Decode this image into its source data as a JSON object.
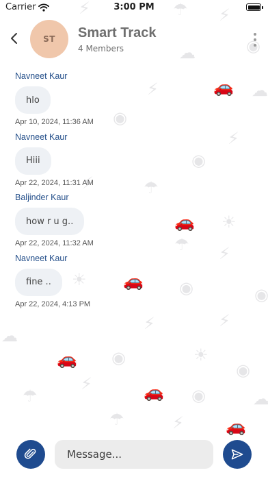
{
  "status_bar": {
    "carrier": "Carrier",
    "time": "3:00 PM"
  },
  "header": {
    "avatar_initials": "ST",
    "title": "Smart Track",
    "subtitle": "4 Members"
  },
  "messages": [
    {
      "sender": "Navneet Kaur",
      "text": "hlo",
      "timestamp": "Apr 10, 2024, 11:36 AM"
    },
    {
      "sender": "Navneet Kaur",
      "text": "Hiii",
      "timestamp": "Apr 22, 2024, 11:31 AM"
    },
    {
      "sender": "Baljinder Kaur",
      "text": "how r u g..",
      "timestamp": "Apr 22, 2024, 11:32 AM"
    },
    {
      "sender": "Navneet Kaur",
      "text": "fine ..",
      "timestamp": "Apr 22, 2024, 4:13 PM"
    }
  ],
  "composer": {
    "placeholder": "Message..."
  },
  "icons": {
    "back": "chevron-left-icon",
    "menu": "more-vertical-icon",
    "attach": "paperclip-icon",
    "send": "send-icon",
    "wallpaper": [
      "cloud-icon",
      "lightning-icon",
      "car-icon",
      "umbrella-icon",
      "sun-icon",
      "eye-icon"
    ]
  },
  "colors": {
    "accent": "#1f4b8f",
    "sender": "#244f8a",
    "avatar": "#f0c7ab",
    "bubble": "#eef1f5",
    "input": "#ececec"
  }
}
